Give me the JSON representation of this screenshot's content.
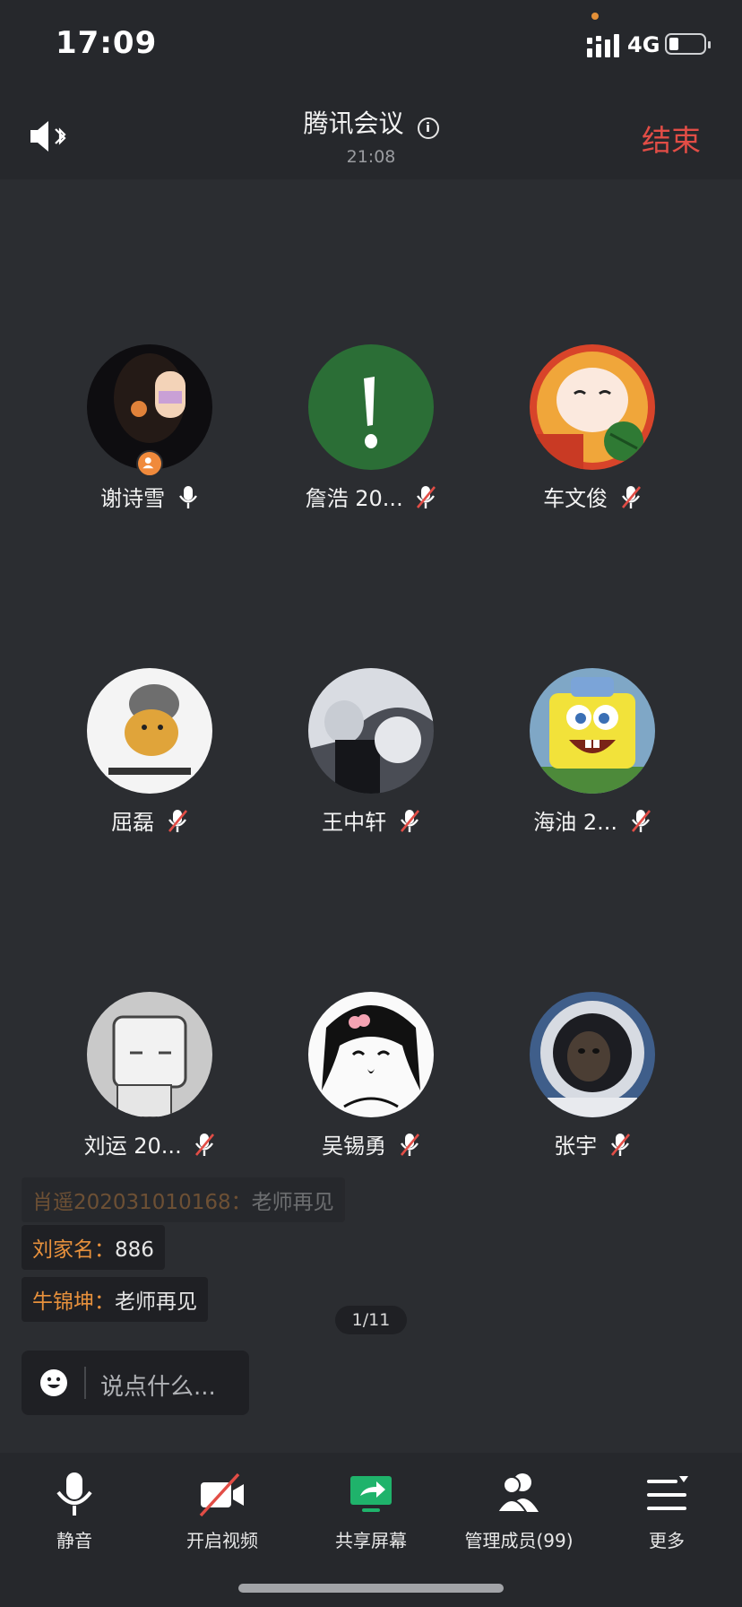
{
  "status_bar": {
    "time": "17:09",
    "network": "4G"
  },
  "header": {
    "title": "腾讯会议",
    "duration": "21:08",
    "end_label": "结束"
  },
  "participants": [
    {
      "name": "谢诗雪",
      "muted": false,
      "host": true
    },
    {
      "name": "詹浩 20...",
      "muted": true
    },
    {
      "name": "车文俊",
      "muted": true
    },
    {
      "name": "屈磊",
      "muted": true
    },
    {
      "name": "王中轩",
      "muted": true
    },
    {
      "name": "海油 2...",
      "muted": true
    },
    {
      "name": "刘运 20...",
      "muted": true
    },
    {
      "name": "吴锡勇",
      "muted": true
    },
    {
      "name": "张宇",
      "muted": true
    }
  ],
  "chat": [
    {
      "sender": "肖遥202031010168：",
      "message": "老师再见"
    },
    {
      "sender": "刘家名：",
      "message": "886"
    },
    {
      "sender": "牛锦坤：",
      "message": "老师再见"
    }
  ],
  "pagination": "1/11",
  "input": {
    "placeholder": "说点什么..."
  },
  "toolbar": {
    "mute": "静音",
    "video": "开启视频",
    "share": "共享屏幕",
    "members": "管理成员(99)",
    "more": "更多"
  },
  "colors": {
    "end": "#e24d46",
    "sender": "#e8913c",
    "share_green": "#1fb36b",
    "background": "#2b2d31"
  }
}
